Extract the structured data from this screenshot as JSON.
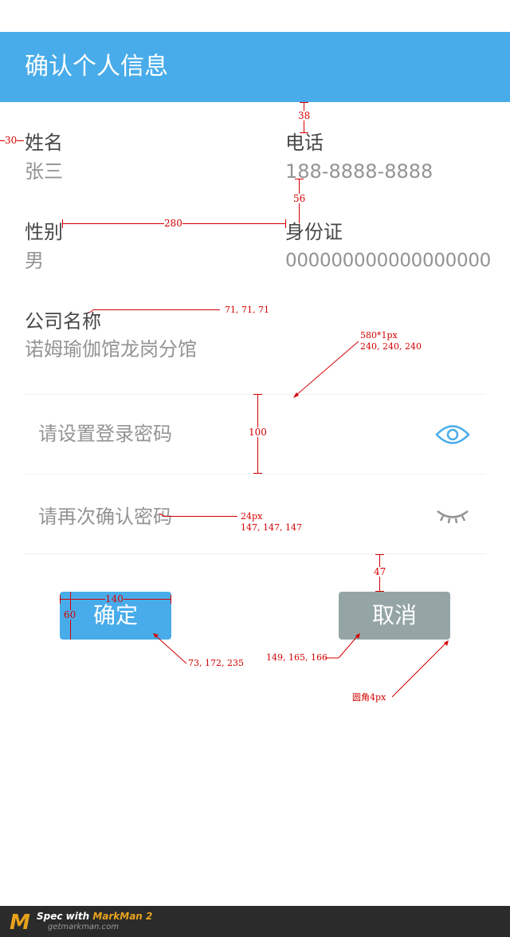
{
  "header": {
    "title": "确认个人信息"
  },
  "fields": {
    "name": {
      "label": "姓名",
      "value": "张三"
    },
    "phone": {
      "label": "电话",
      "value": "188-8888-8888"
    },
    "gender": {
      "label": "性别",
      "value": "男"
    },
    "id_card": {
      "label": "身份证",
      "value": "000000000000000000"
    },
    "company": {
      "label": "公司名称",
      "value": "诺姆瑜伽馆龙岗分馆"
    }
  },
  "password": {
    "login_placeholder": "请设置登录密码",
    "confirm_placeholder": "请再次确认密码",
    "show_icon": "eye-icon",
    "hide_icon": "eye-closed-icon"
  },
  "buttons": {
    "confirm_label": "确定",
    "cancel_label": "取消"
  },
  "colors": {
    "primary": "#49acea",
    "cancel": "#95a5a6",
    "label_text": "#474747",
    "value_text": "#939393",
    "divider": "#f0f0f0"
  },
  "annotations": {
    "a38": "38",
    "a30": "30",
    "a56": "56",
    "a280": "280",
    "label_color": "71, 71, 71",
    "divider_size": "580*1px",
    "divider_color": "240, 240, 240",
    "a100": "100",
    "font_size": "24px",
    "placeholder_color": "147, 147, 147",
    "a47": "47",
    "a140": "140",
    "a60": "60",
    "confirm_color": "73, 172, 235",
    "cancel_color": "149, 165, 166",
    "radius": "圆角4px"
  },
  "footer": {
    "logo": "M",
    "spec_text": "Spec with ",
    "brand": "MarkMan 2",
    "url": "getmarkman.com"
  }
}
